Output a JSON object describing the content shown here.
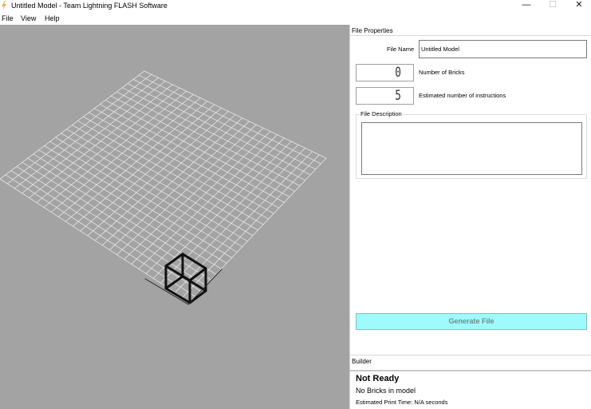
{
  "window": {
    "title": "Untitled Model - Team Lightning FLASH Software",
    "minimize_glyph": "—",
    "maximize_glyph": "☐",
    "close_glyph": "✕",
    "icon": "lightning-icon",
    "icon_color": "#e8b04a"
  },
  "menu": {
    "file": "File",
    "view": "View",
    "help": "Help"
  },
  "viewport": {
    "background_color": "#a3a3a3",
    "grid_color": "#e6e6e6",
    "cursor_color": "#111111"
  },
  "file_properties": {
    "heading": "File Properties",
    "file_name_label": "File Name",
    "file_name_value": "Untitled Model",
    "bricks_value": "0",
    "bricks_label": "Number of Bricks",
    "instructions_value": "5",
    "instructions_label": "Estimated number of instructions",
    "description_label": "File Description",
    "description_value": "",
    "generate_button": "Generate File",
    "generate_button_color": "#9ffafb"
  },
  "builder": {
    "heading": "Builder",
    "status_title": "Not Ready",
    "status_text": "No Bricks in model",
    "print_time": "Estimated Print Time: N/A seconds"
  }
}
